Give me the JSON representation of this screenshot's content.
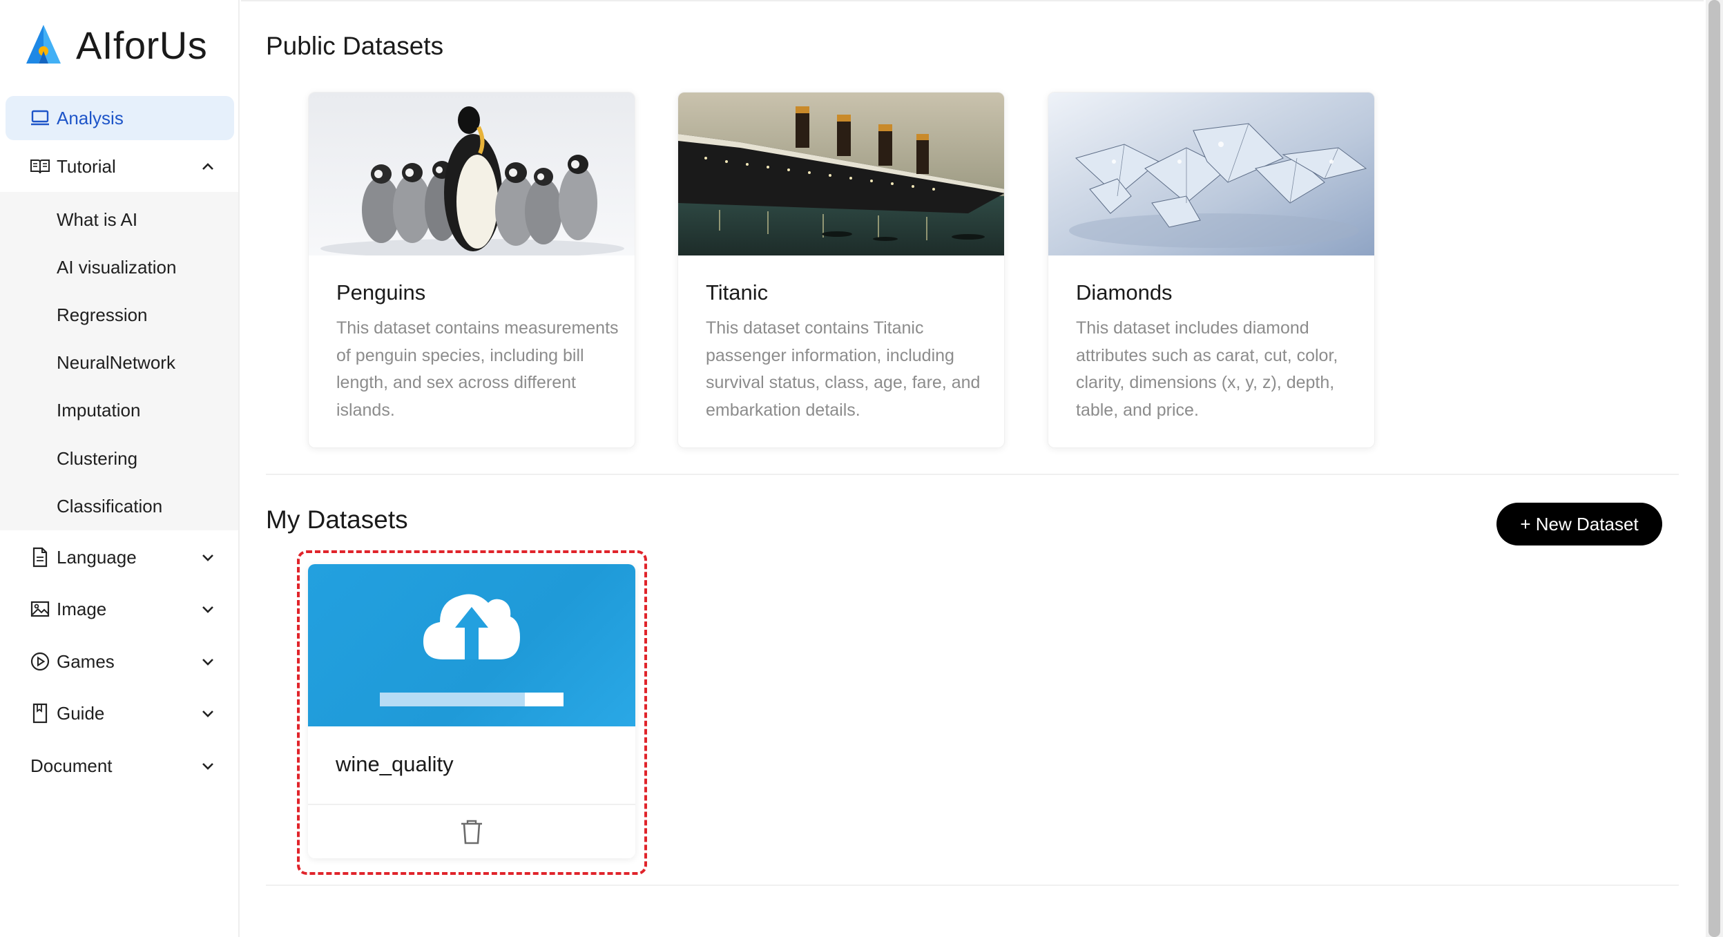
{
  "app": {
    "logo_text": "AIforUs",
    "brand_color": "#1e88e5"
  },
  "sidebar": {
    "items": [
      {
        "label": "Analysis",
        "icon": "laptop-icon",
        "state": "active"
      },
      {
        "label": "Tutorial",
        "icon": "book-open-icon",
        "expanded": true
      },
      {
        "label": "Language",
        "icon": "document-icon",
        "expanded": false
      },
      {
        "label": "Image",
        "icon": "image-icon",
        "expanded": false
      },
      {
        "label": "Games",
        "icon": "play-circle-icon",
        "expanded": false
      },
      {
        "label": "Guide",
        "icon": "bookmark-book-icon",
        "expanded": false
      },
      {
        "label": "Document",
        "icon": "",
        "expanded": false
      }
    ],
    "tutorial_children": [
      "What is AI",
      "AI visualization",
      "Regression",
      "NeuralNetwork",
      "Imputation",
      "Clustering",
      "Classification"
    ]
  },
  "public_datasets": {
    "title": "Public Datasets",
    "cards": [
      {
        "title": "Penguins",
        "description": "This dataset contains measurements of penguin species, including bill length, and sex across different islands.",
        "image": "penguins-photo"
      },
      {
        "title": "Titanic",
        "description": "This dataset contains Titanic passenger information, including survival status, class, age, fare, and embarkation details.",
        "image": "titanic-painting"
      },
      {
        "title": "Diamonds",
        "description": "This dataset includes diamond attributes such as carat, cut, color, clarity, dimensions (x, y, z), depth, table, and price.",
        "image": "diamonds-photo"
      }
    ]
  },
  "my_datasets": {
    "title": "My Datasets",
    "new_button": "+ New Dataset",
    "cards": [
      {
        "title": "wine_quality",
        "image": "cloud-upload-icon",
        "upload_progress": 0.79,
        "delete_icon": "trash-icon"
      }
    ]
  },
  "colors": {
    "active_bg": "#e6f0fb",
    "active_text": "#1e55c8",
    "upload_blue": "#1f9ad8",
    "highlight_red": "#e0242b"
  }
}
